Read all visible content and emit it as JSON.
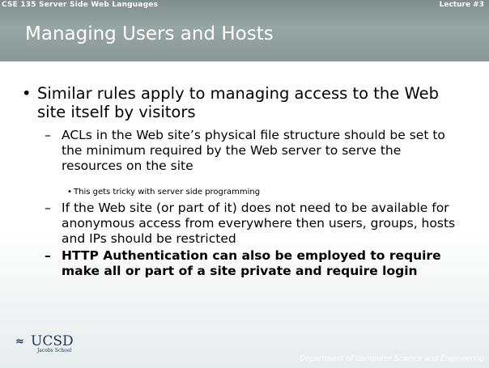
{
  "header": {
    "course": "CSE 135 Server Side Web Languages",
    "lecture": "Lecture #3",
    "title": "Managing Users and Hosts"
  },
  "bullets": [
    {
      "level": 1,
      "mark": "•",
      "text": "Similar rules apply to managing access to the Web site itself by visitors"
    },
    {
      "level": 2,
      "mark": "–",
      "text": "ACLs in the Web site’s physical file structure should be set to the minimum required by the Web server to serve the resources on the site"
    },
    {
      "level": 3,
      "mark": "•",
      "text": "This gets tricky with server side programming"
    },
    {
      "level": 2,
      "mark": "–",
      "text": "If the Web site (or part of it) does not need to be available for anonymous access from everywhere then users, groups, hosts and IPs should be restricted"
    },
    {
      "level": 2,
      "mark": "–",
      "text": "HTTP Authentication can also be employed to require make all or part of a site private and require login",
      "bold": true
    }
  ],
  "footer": {
    "logo_name": "UCSD",
    "logo_sub": "Jacobs School",
    "department": "Department of Computer Science and Engineering"
  },
  "colors": {
    "header": "#8f9e9a",
    "logo": "#203a5b",
    "text": "#000000"
  },
  "icons": {
    "logo": "trident-wave-icon"
  }
}
